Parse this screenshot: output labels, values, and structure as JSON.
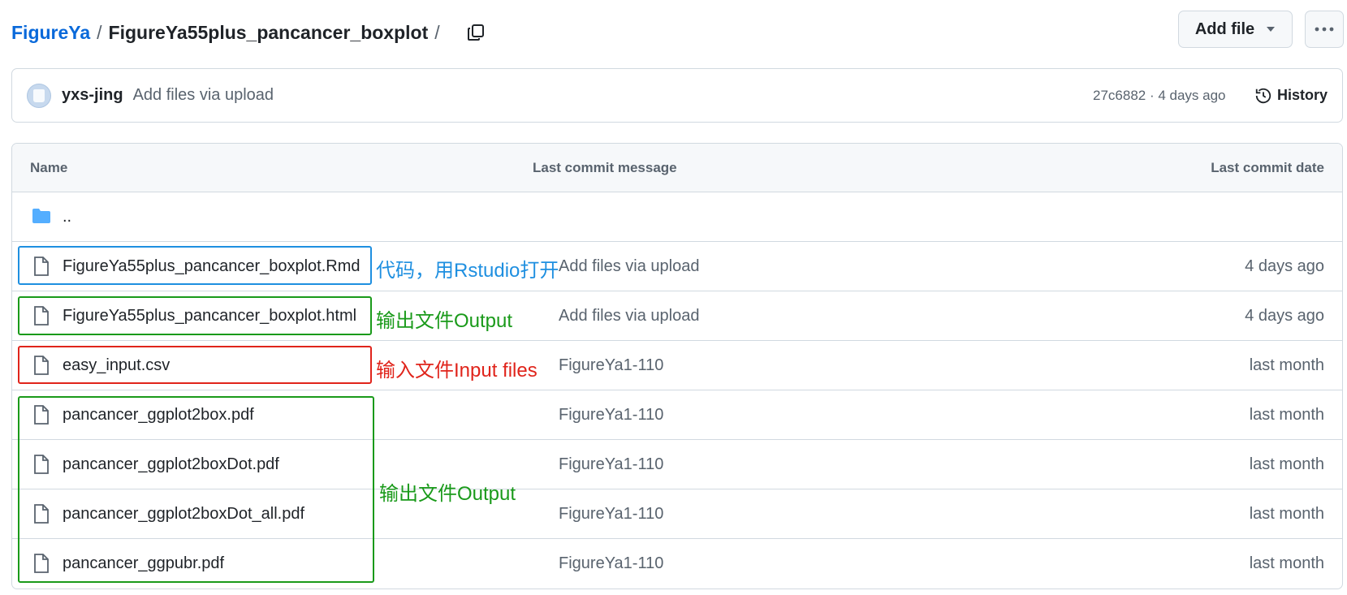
{
  "breadcrumb": {
    "repo": "FigureYa",
    "separator": "/",
    "folder": "FigureYa55plus_pancancer_boxplot",
    "trailing": "/"
  },
  "toolbar": {
    "add_file_label": "Add file",
    "more_icon": "kebab-horizontal-icon"
  },
  "commit": {
    "author": "yxs-jing",
    "message": "Add files via upload",
    "meta": "27c6882 · 4 days ago",
    "history_label": "History"
  },
  "table": {
    "headers": {
      "name": "Name",
      "message": "Last commit message",
      "date": "Last commit date"
    },
    "parent_label": "..",
    "rows": [
      {
        "name": "FigureYa55plus_pancancer_boxplot.Rmd",
        "message": "Add files via upload",
        "date": "4 days ago"
      },
      {
        "name": "FigureYa55plus_pancancer_boxplot.html",
        "message": "Add files via upload",
        "date": "4 days ago"
      },
      {
        "name": "easy_input.csv",
        "message": "FigureYa1-110",
        "date": "last month"
      },
      {
        "name": "pancancer_ggplot2box.pdf",
        "message": "FigureYa1-110",
        "date": "last month"
      },
      {
        "name": "pancancer_ggplot2boxDot.pdf",
        "message": "FigureYa1-110",
        "date": "last month"
      },
      {
        "name": "pancancer_ggplot2boxDot_all.pdf",
        "message": "FigureYa1-110",
        "date": "last month"
      },
      {
        "name": "pancancer_ggpubr.pdf",
        "message": "FigureYa1-110",
        "date": "last month"
      }
    ]
  },
  "annotations": {
    "code": "代码，用Rstudio打开",
    "output_single": "输出文件Output",
    "input": "输入文件Input files",
    "output_group": "输出文件Output"
  },
  "colors": {
    "link": "#0969da",
    "folder": "#54aeff",
    "annotation_blue": "#1e8fe0",
    "annotation_green": "#1a9a1a",
    "annotation_red": "#e0241b"
  }
}
